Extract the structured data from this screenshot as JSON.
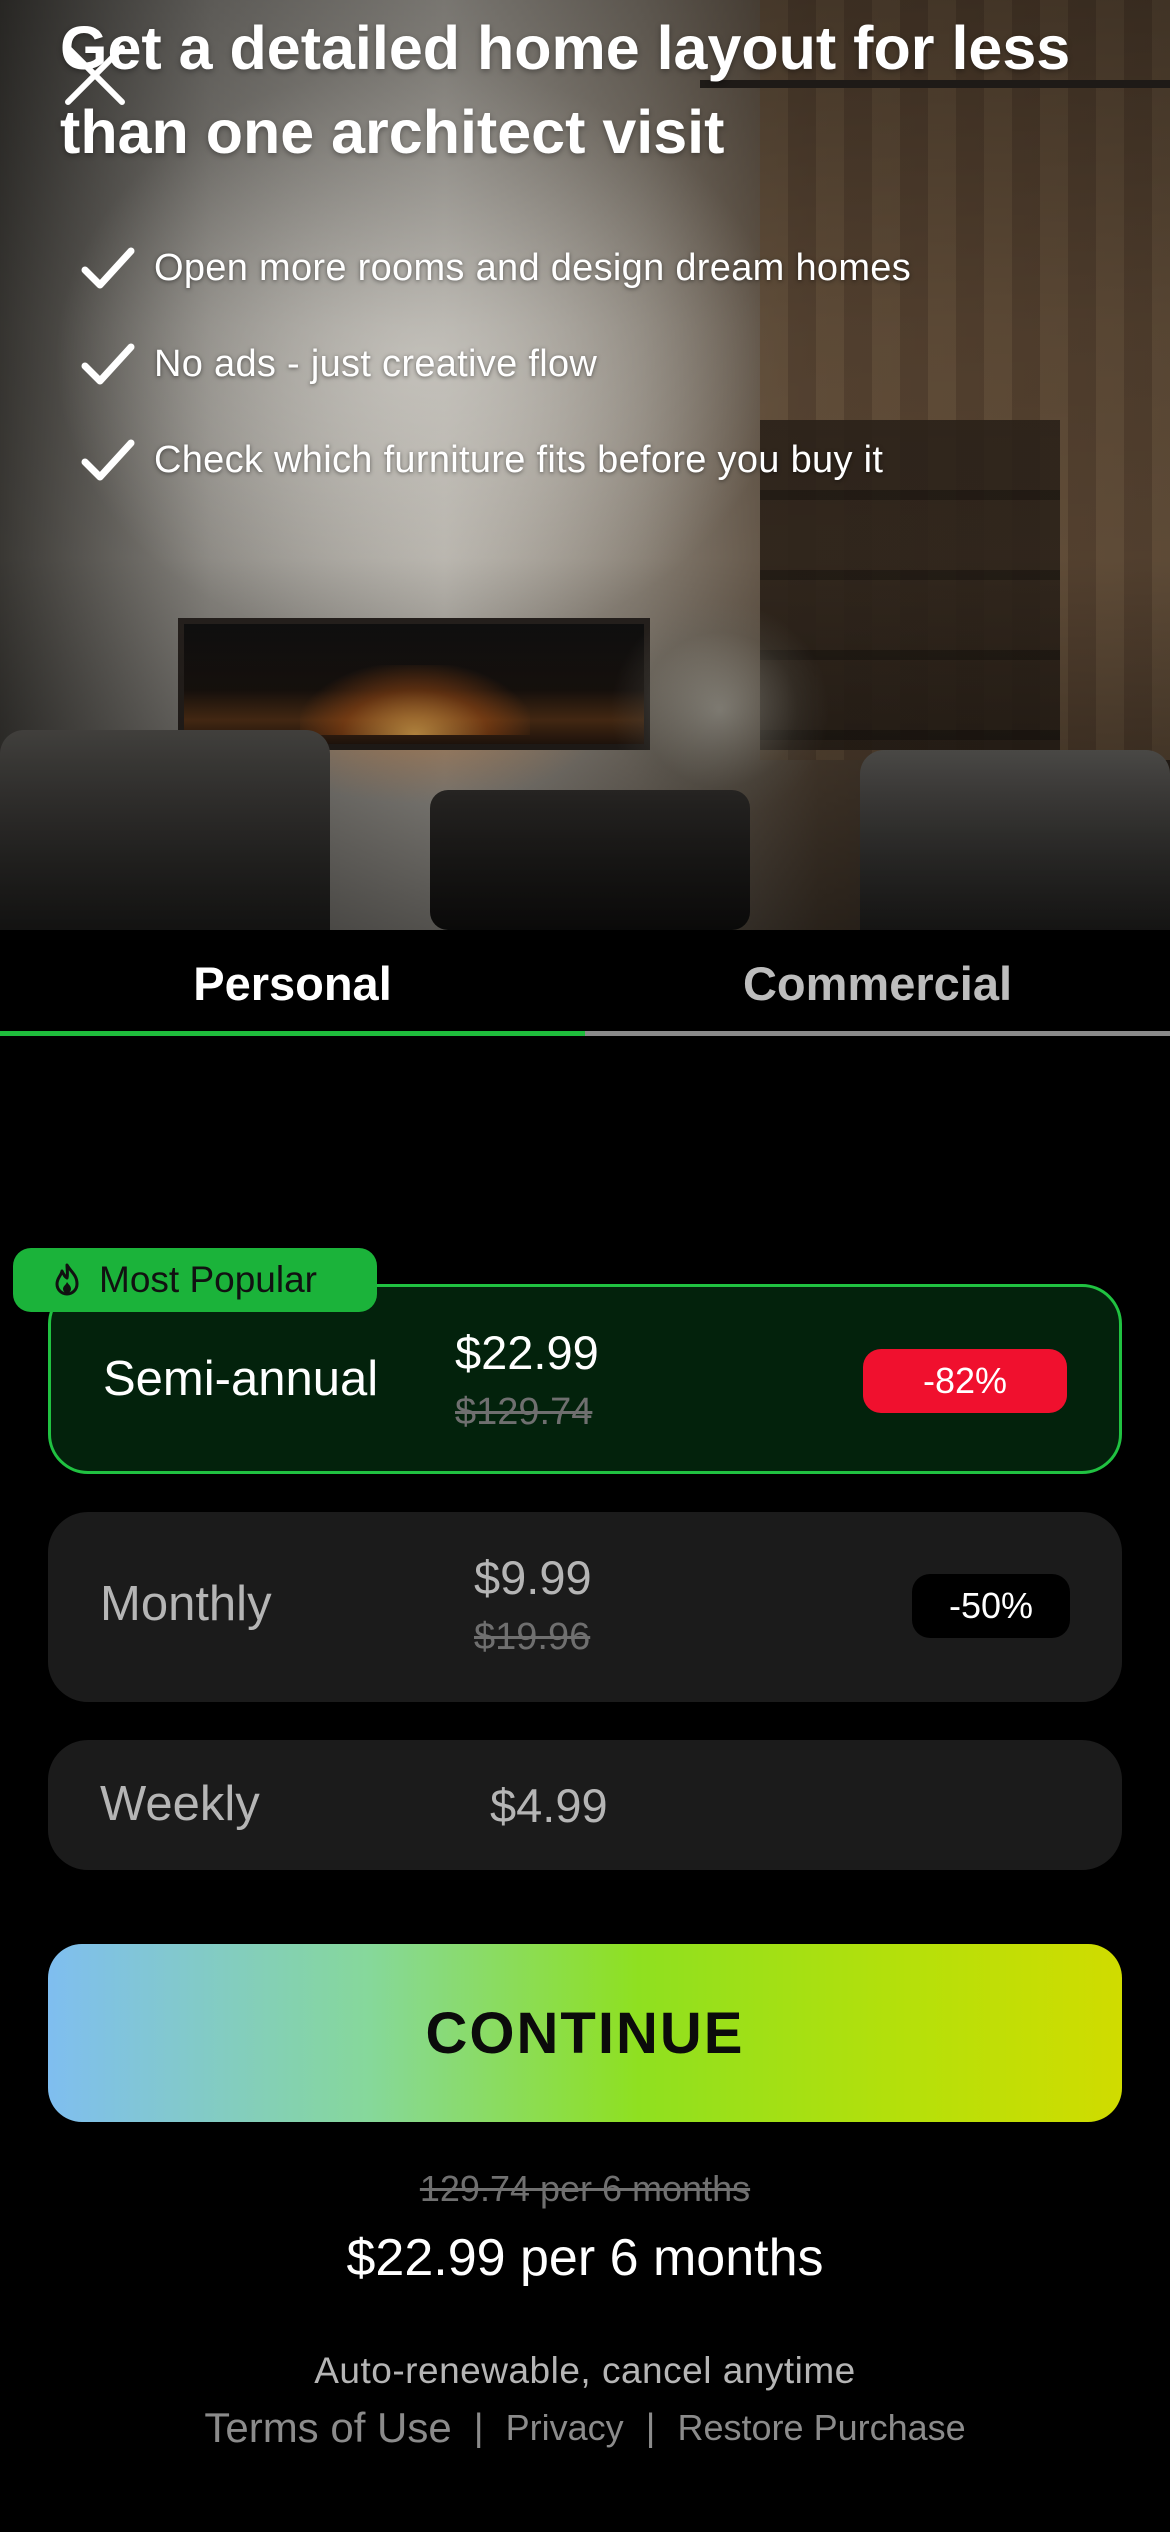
{
  "header": {
    "title": "Get a detailed home layout for less than one architect visit",
    "close_icon": "close-icon"
  },
  "features": [
    {
      "icon": "checkmark-icon",
      "text": "Open more rooms and design dream homes"
    },
    {
      "icon": "checkmark-icon",
      "text": "No ads - just creative flow"
    },
    {
      "icon": "checkmark-icon",
      "text": "Check which furniture fits before you buy it"
    }
  ],
  "tabs": [
    {
      "label": "Personal",
      "active": true
    },
    {
      "label": "Commercial",
      "active": false
    }
  ],
  "popular_badge": {
    "icon": "flame-icon",
    "label": "Most Popular"
  },
  "plans": [
    {
      "name": "Semi-annual",
      "price": "$22.99",
      "old_price": "$129.74",
      "discount": "-82%",
      "selected": true
    },
    {
      "name": "Monthly",
      "price": "$9.99",
      "old_price": "$19.96",
      "discount": "-50%",
      "selected": false
    },
    {
      "name": "Weekly",
      "price": "$4.99",
      "selected": false
    }
  ],
  "cta": {
    "label": "CONTINUE"
  },
  "summary": {
    "old_total": "129.74 per 6 months",
    "new_total": "$22.99 per 6 months",
    "renewal_note": "Auto-renewable, cancel anytime"
  },
  "footer": {
    "terms": "Terms of Use",
    "privacy": "Privacy",
    "restore": "Restore Purchase",
    "separator": "|"
  },
  "colors": {
    "accent_green": "#1fbd3c",
    "discount_red": "#f0102e",
    "selected_bg": "#03220c",
    "card_bg": "#1b1b1b"
  }
}
